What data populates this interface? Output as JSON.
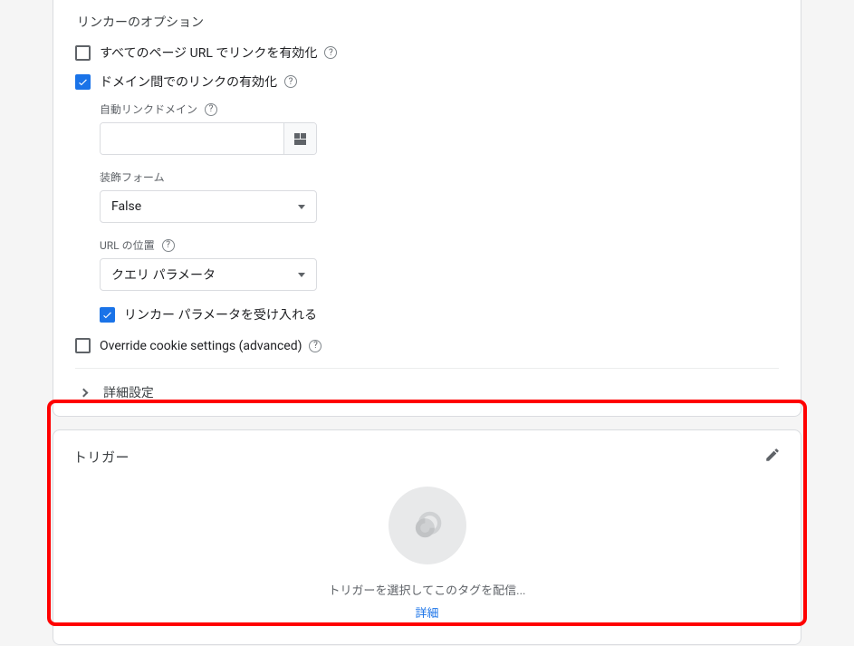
{
  "linker": {
    "section_title": "リンカーのオプション",
    "enable_all_label": "すべてのページ URL でリンクを有効化",
    "cross_domain_label": "ドメイン間でのリンクの有効化",
    "auto_link_domain_label": "自動リンクドメイン",
    "auto_link_domain_value": "",
    "decorate_forms_label": "装飾フォーム",
    "decorate_forms_value": "False",
    "url_position_label": "URL の位置",
    "url_position_value": "クエリ パラメータ",
    "accept_linker_label": "リンカー パラメータを受け入れる",
    "override_cookie_label": "Override cookie settings (advanced)",
    "advanced_label": "詳細設定"
  },
  "trigger": {
    "title": "トリガー",
    "placeholder_text": "トリガーを選択してこのタグを配信...",
    "link": "詳細"
  }
}
